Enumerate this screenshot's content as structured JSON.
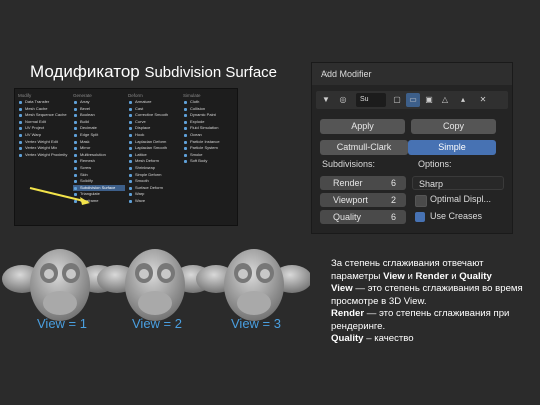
{
  "title": {
    "main": "Модификатор ",
    "en": "Subdivision Surface"
  },
  "menu": {
    "columns": [
      {
        "head": "Modify",
        "items": [
          "Data Transfer",
          "Mesh Cache",
          "Mesh Sequence Cache",
          "Normal Edit",
          "UV Project",
          "UV Warp",
          "Vertex Weight Edit",
          "Vertex Weight Mix",
          "Vertex Weight Proximity"
        ]
      },
      {
        "head": "Generate",
        "items": [
          "Array",
          "Bevel",
          "Boolean",
          "Build",
          "Decimate",
          "Edge Split",
          "Mask",
          "Mirror",
          "Multiresolution",
          "Remesh",
          "Screw",
          "Skin",
          "Solidify",
          "Subdivision Surface",
          "Triangulate",
          "Wireframe"
        ]
      },
      {
        "head": "Deform",
        "items": [
          "Armature",
          "Cast",
          "Corrective Smooth",
          "Curve",
          "Displace",
          "Hook",
          "Laplacian Deform",
          "Laplacian Smooth",
          "Lattice",
          "Mesh Deform",
          "Shrinkwrap",
          "Simple Deform",
          "Smooth",
          "Surface Deform",
          "Warp",
          "Wave"
        ]
      },
      {
        "head": "Simulate",
        "items": [
          "Cloth",
          "Collision",
          "Dynamic Paint",
          "Explode",
          "Fluid Simulation",
          "Ocean",
          "Particle Instance",
          "Particle System",
          "Smoke",
          "Soft Body"
        ]
      }
    ]
  },
  "views": [
    "View = 1",
    "View = 2",
    "View = 3"
  ],
  "panel": {
    "title": "Add Modifier",
    "dots": "::::",
    "name": "Su",
    "apply": "Apply",
    "copy": "Copy",
    "catmull": "Catmull-Clark",
    "simple": "Simple",
    "subdivisions_label": "Subdivisions:",
    "options_label": "Options:",
    "render_label": "Render",
    "render_value": "6",
    "viewport_label": "Viewport",
    "viewport_value": "2",
    "quality_label": "Quality",
    "quality_value": "6",
    "uv_mode": "Sharp",
    "optimal_display": "Optimal Displ...",
    "use_creases": "Use Creases",
    "colors": {
      "accent": "#4772b3"
    }
  },
  "desc": {
    "l1": "За степень сглаживания отвечают параметры ",
    "b1": "View",
    "l2": " и ",
    "b2": "Render",
    "l3": " и ",
    "b3": "Quality",
    "b4": "View",
    "l4": " — это степень сглаживания во время просмотре в 3D View.",
    "b5": "Render",
    "l5": " — это степень сглаживания при рендеринге.",
    "b6": "Quality",
    "l6": " – качество"
  }
}
